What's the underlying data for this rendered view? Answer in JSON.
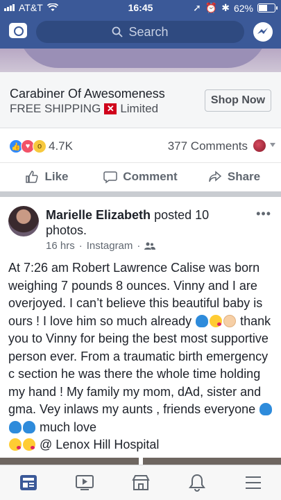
{
  "status_bar": {
    "carrier": "AT&T",
    "time": "16:45",
    "battery": "62%",
    "battery_level": 0.62
  },
  "nav": {
    "search_placeholder": "Search"
  },
  "ad": {
    "title": "Carabiner Of Awesomeness",
    "shipping": "FREE SHIPPING",
    "limited": "Limited",
    "cta": "Shop Now"
  },
  "reactions": {
    "count": "4.7K",
    "comments": "377 Comments",
    "icons": [
      "like-reaction",
      "love-reaction",
      "wow-reaction"
    ]
  },
  "actions": {
    "like": "Like",
    "comment": "Comment",
    "share": "Share"
  },
  "post": {
    "author": "Marielle Elizabeth",
    "action": " posted 10 photos.",
    "time": "16 hrs",
    "source": "Instagram",
    "text_1": "At 7:26 am Robert Lawrence Calise was born weighing 7 pounds 8 ounces. Vinny and I are overjoyed. I can’t believe this beautiful baby is ours ! I love him so much already ",
    "text_2": " thank you to Vinny for being the best most supportive person ever. From a traumatic birth emergency c section he was there the whole time holding my hand ! My family my mom, dAd, sister and gma. Vey inlaws my aunts , friends everyone ",
    "text_3": " much love ",
    "text_4": " @ Lenox Hill Hospital"
  },
  "colors": {
    "brand": "#3b5998",
    "like": "#2e89ff",
    "love": "#f25268",
    "wow": "#f7c93e"
  },
  "tabbar": [
    "news-feed",
    "watch",
    "marketplace",
    "notifications",
    "menu"
  ]
}
